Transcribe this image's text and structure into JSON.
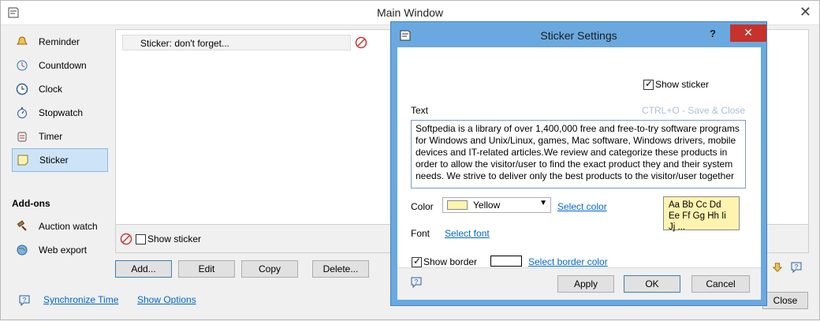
{
  "main_window": {
    "title": "Main Window",
    "sidebar": {
      "items": [
        {
          "label": "Reminder",
          "icon": "bell-icon"
        },
        {
          "label": "Countdown",
          "icon": "countdown-icon"
        },
        {
          "label": "Clock",
          "icon": "clock-icon"
        },
        {
          "label": "Stopwatch",
          "icon": "stopwatch-icon"
        },
        {
          "label": "Timer",
          "icon": "timer-icon"
        },
        {
          "label": "Sticker",
          "icon": "sticker-icon",
          "active": true
        }
      ],
      "addons_label": "Add-ons",
      "addons": [
        {
          "label": "Auction watch",
          "icon": "gavel-icon"
        },
        {
          "label": "Web export",
          "icon": "globe-icon"
        }
      ]
    },
    "list": {
      "rows": [
        "Sticker: don't forget..."
      ]
    },
    "show_sticker_label": "Show sticker",
    "buttons": {
      "add": "Add...",
      "edit": "Edit",
      "copy": "Copy",
      "delete": "Delete..."
    },
    "footer": {
      "sync": "Synchronize Time",
      "options": "Show Options",
      "close": "Close"
    }
  },
  "dialog": {
    "title": "Sticker Settings",
    "help": "?",
    "show_sticker_label": "Show sticker",
    "text_label": "Text",
    "shortcut_hint": "CTRL+O  - Save & Close",
    "text_value": "Softpedia is a library of over 1,400,000 free and free-to-try software programs for Windows and Unix/Linux, games, Mac software, Windows drivers, mobile devices and IT-related articles.We review and categorize these products in order to allow the visitor/user to find the exact product they and their system needs. We strive to deliver only the best products to the visitor/user together",
    "color_label": "Color",
    "color_value": "Yellow",
    "select_color": "Select color",
    "font_label": "Font",
    "select_font": "Select font",
    "font_preview": "Aa Bb Cc Dd Ee Ff Gg Hh Ii Jj ...",
    "show_border_label": "Show border",
    "select_border_color": "Select border color",
    "buttons": {
      "apply": "Apply",
      "ok": "OK",
      "cancel": "Cancel"
    }
  },
  "colors": {
    "sticker_yellow": "#fff3b0",
    "dialog_frame": "#6aa9e0",
    "close_red": "#c7322b",
    "link": "#0066cc"
  }
}
